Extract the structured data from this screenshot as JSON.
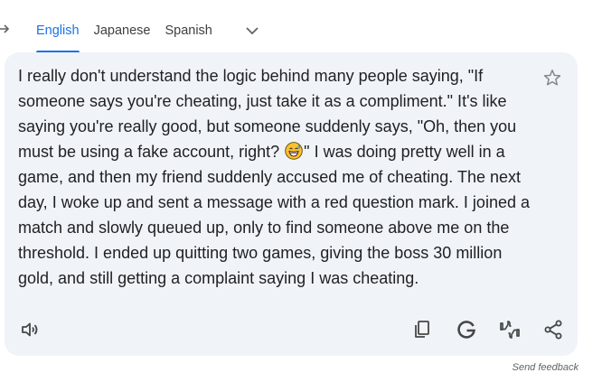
{
  "languages": {
    "tabs": [
      "English",
      "Japanese",
      "Spanish"
    ],
    "active_index": 0
  },
  "result": {
    "text_before_emoji": "I really don't understand the logic behind many people saying, \"If someone says you're cheating, just take it as a compliment.\" It's like saying you're really good, but someone suddenly says, \"Oh, then you must be using a fake account, right? ",
    "emoji": "grinning-sweat-emoji",
    "text_after_emoji": "\" I was doing pretty well in a game, and then my friend suddenly accused me of cheating. The next day, I woke up and sent a message with a red question mark. I joined a match and slowly queued up, only to find someone above me on the threshold. I ended up quitting two games, giving the boss 30 million gold, and still getting a complaint saying I was cheating."
  },
  "icons": {
    "star": "star-icon",
    "listen": "speaker-icon",
    "copy": "copy-icon",
    "google": "google-icon",
    "rate": "thumbs-rating-icon",
    "share": "share-icon"
  },
  "colors": {
    "accent": "#1a73e8",
    "card_bg": "#f0f4f9",
    "text": "#202124",
    "icon": "#444746"
  },
  "footer": {
    "feedback_label": "Send feedback"
  }
}
